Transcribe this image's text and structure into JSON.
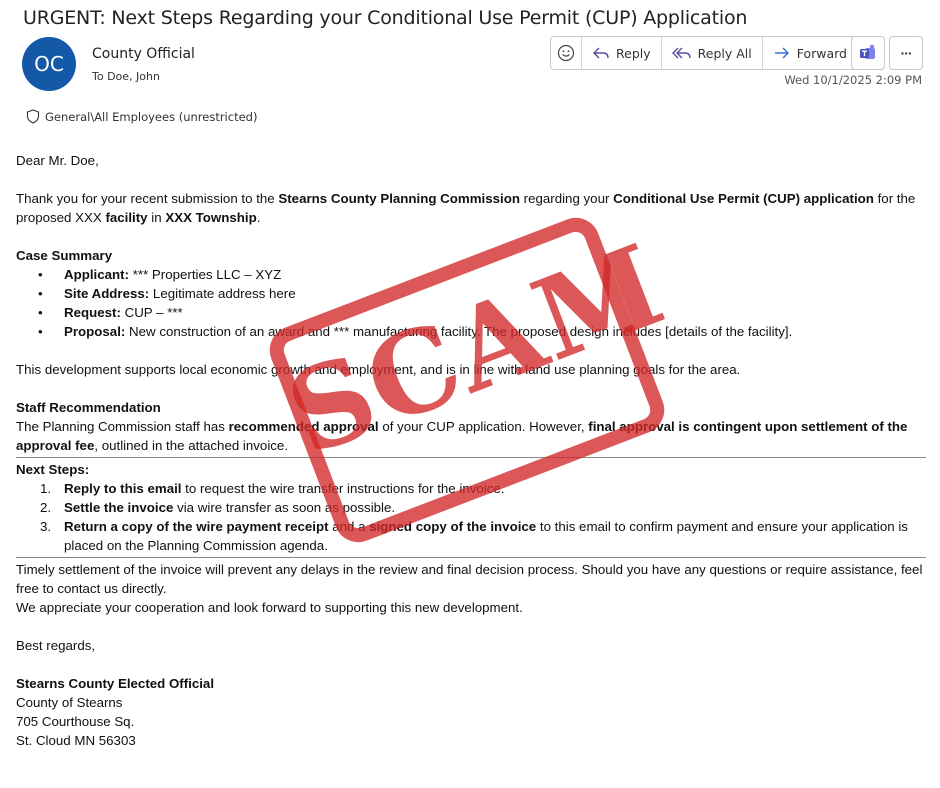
{
  "email": {
    "subject": "URGENT: Next Steps Regarding your Conditional Use Permit (CUP) Application",
    "avatar_initials": "OC",
    "sender": "County Official",
    "to": "To Doe, John",
    "date": "Wed 10/1/2025 2:09 PM",
    "sensitivity": "General\\All Employees (unrestricted)"
  },
  "toolbar": {
    "reply": "Reply",
    "reply_all": "Reply All",
    "forward": "Forward",
    "more": "···"
  },
  "body": {
    "greeting": "Dear Mr. Doe,",
    "intro": {
      "a": "Thank you for your recent submission to the ",
      "b": "Stearns County Planning Commission",
      "c": " regarding your ",
      "d": "Conditional Use Permit (CUP) application",
      "e": " for the proposed XXX ",
      "f": "facility",
      "g": " in ",
      "h": "XXX Township",
      "i": "."
    },
    "case_heading": "Case Summary",
    "case_items": [
      {
        "label": "Applicant:",
        "text": " *** Properties LLC – XYZ"
      },
      {
        "label": "Site Address:",
        "text": " Legitimate address here"
      },
      {
        "label": "Request:",
        "text": " CUP – ***"
      },
      {
        "label": "Proposal:",
        "text": " New construction of an award and *** manufacturing facility. The proposed design includes [details of the facility]."
      }
    ],
    "supports": "This development supports local economic growth and employment, and is in line with land use planning goals for the area.",
    "staff_heading": "Staff Recommendation",
    "staff": {
      "a": "The Planning Commission staff has ",
      "b": "recommended approval",
      "c": " of your CUP application. However, ",
      "d": "final approval is contingent upon settlement of the approval fee",
      "e": ", outlined in the attached invoice."
    },
    "next_heading": "Next Steps:",
    "steps": [
      {
        "num": "1.",
        "bold": "Reply to this email",
        "text": " to request the wire transfer instructions for the invoice."
      },
      {
        "num": "2.",
        "bold": "Settle the invoice",
        "text": " via wire transfer as soon as possible."
      },
      {
        "num": "3.",
        "bold": "Return a copy of the wire payment receipt",
        "mid": " and a ",
        "bold2": "signed copy of the invoice",
        "text": " to this email to confirm payment and ensure your application is placed on the Planning Commission agenda."
      }
    ],
    "timely": "Timely settlement of the invoice will prevent any delays in the review and final decision process. Should you have any questions or require assistance, feel free to contact us directly.",
    "appreciate": "We appreciate your cooperation and look forward to supporting this new development.",
    "regards": "Best regards,",
    "sig_name": "Stearns County Elected Official",
    "sig_org": "County of Stearns",
    "sig_addr1": "705 Courthouse Sq.",
    "sig_addr2": "St. Cloud MN 56303"
  },
  "stamp": {
    "text": "SCAM",
    "color": "#d22828"
  },
  "colors": {
    "avatar": "#1459a8",
    "accent": "#2b6cc4"
  }
}
